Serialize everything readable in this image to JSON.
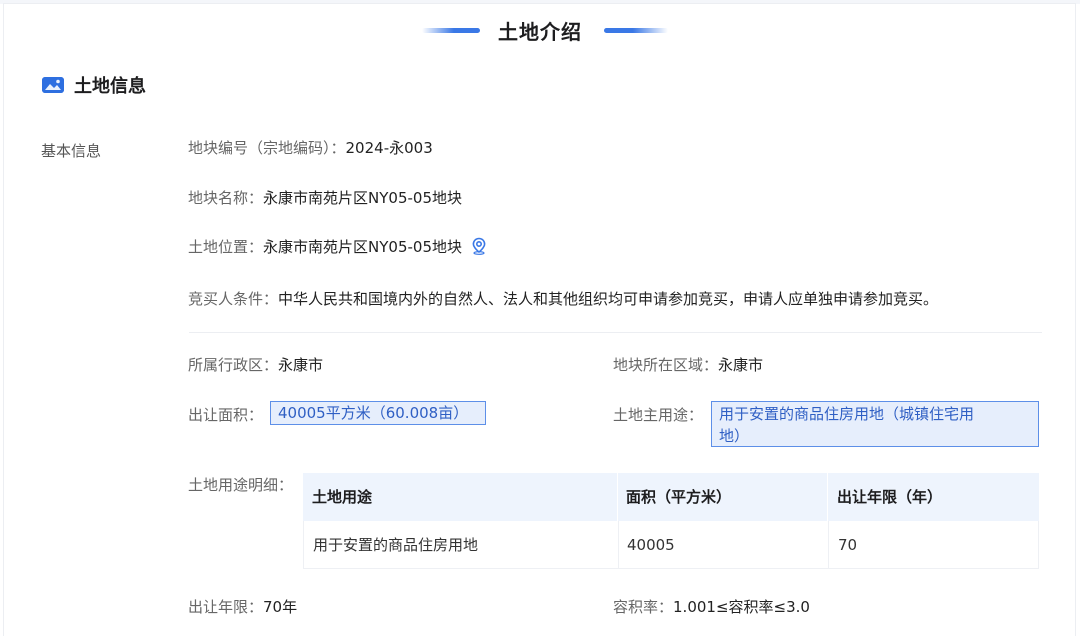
{
  "section": {
    "title": "土地介绍"
  },
  "subsection": {
    "title": "土地信息"
  },
  "basic_label": "基本信息",
  "fields": {
    "parcel_code": {
      "key": "地块编号（宗地编码）：",
      "value": "2024-永003"
    },
    "parcel_name": {
      "key": "地块名称：",
      "value": "永康市南苑片区NY05-05地块"
    },
    "parcel_location": {
      "key": "土地位置：",
      "value": "永康市南苑片区NY05-05地块"
    },
    "bidder_conditions": {
      "key": "竞买人条件：",
      "value": "中华人民共和国境内外的自然人、法人和其他组织均可申请参加竞买，申请人应单独申请参加竞买。"
    },
    "admin_district": {
      "key": "所属行政区：",
      "value": "永康市"
    },
    "parcel_region": {
      "key": "地块所在区域：",
      "value": "永康市"
    },
    "transfer_area": {
      "key": "出让面积：",
      "value": "40005平方米（60.008亩）"
    },
    "main_use": {
      "key": "土地主用途：",
      "value_line1": "用于安置的商品住房用地（城镇住宅用",
      "value_line2": "地）"
    },
    "use_detail": {
      "key": "土地用途明细："
    },
    "transfer_term": {
      "key": "出让年限：",
      "value": "70年"
    },
    "plot_ratio": {
      "key": "容积率：",
      "value": "1.001≤容积率≤3.0"
    }
  },
  "use_table": {
    "headers": [
      "土地用途",
      "面积（平方米）",
      "出让年限（年）"
    ],
    "rows": [
      [
        "用于安置的商品住房用地",
        "40005",
        "70"
      ]
    ]
  },
  "icons": {
    "subsection_icon": "image-icon",
    "location_icon": "map-pin-icon"
  },
  "colors": {
    "accent": "#2e6fe0",
    "highlight_bg": "#e6eefc",
    "highlight_border": "#5d8fe8",
    "table_header_bg": "#eef4fd"
  }
}
